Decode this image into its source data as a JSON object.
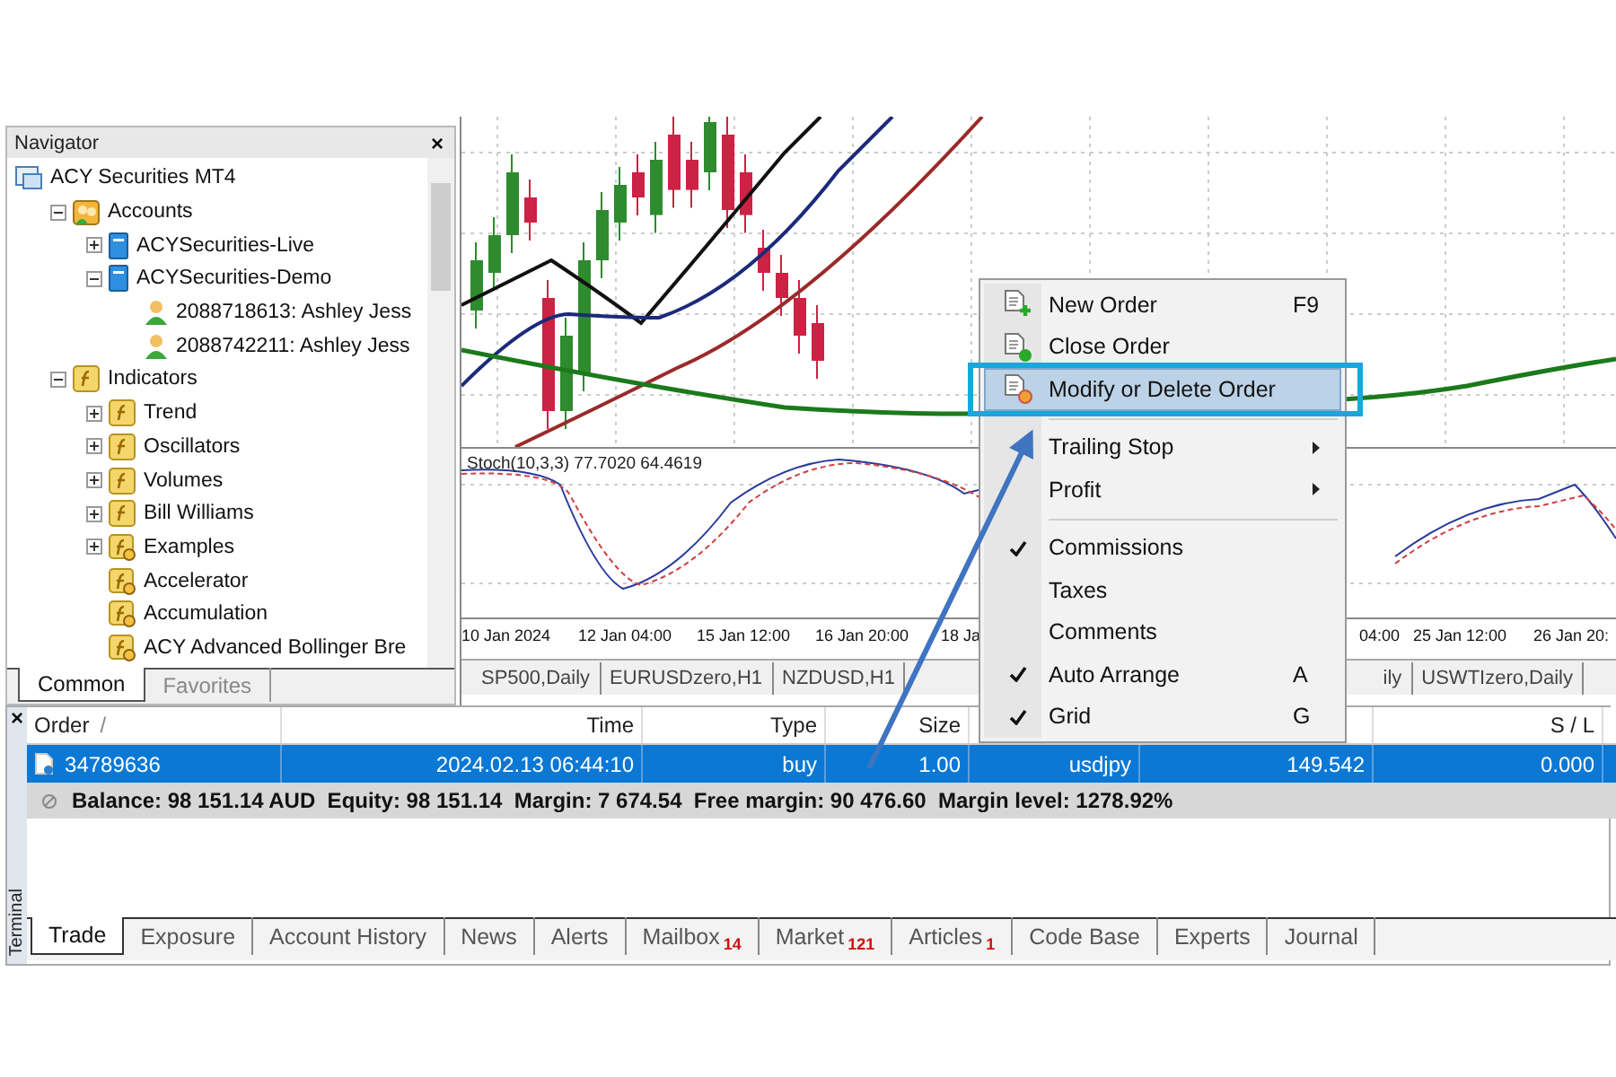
{
  "navigator": {
    "title": "Navigator",
    "close": "×",
    "tree": [
      {
        "label": "ACY Securities MT4",
        "kind": "terminal",
        "children": [
          {
            "label": "Accounts",
            "kind": "accounts",
            "expanded": true,
            "children": [
              {
                "label": "ACYSecurities-Live",
                "kind": "server",
                "expanded": false
              },
              {
                "label": "ACYSecurities-Demo",
                "kind": "server",
                "expanded": true,
                "children": [
                  {
                    "label": "2088718613: Ashley Jess",
                    "kind": "user"
                  },
                  {
                    "label": "2088742211: Ashley Jess",
                    "kind": "user"
                  }
                ]
              }
            ]
          },
          {
            "label": "Indicators",
            "kind": "folder",
            "expanded": true,
            "children": [
              {
                "label": "Trend",
                "kind": "folder",
                "expanded": false
              },
              {
                "label": "Oscillators",
                "kind": "folder",
                "expanded": false
              },
              {
                "label": "Volumes",
                "kind": "folder",
                "expanded": false
              },
              {
                "label": "Bill Williams",
                "kind": "folder",
                "expanded": false
              },
              {
                "label": "Examples",
                "kind": "indicator",
                "expanded": false
              },
              {
                "label": "Accelerator",
                "kind": "indicator"
              },
              {
                "label": "Accumulation",
                "kind": "indicator"
              },
              {
                "label": "ACY Advanced Bollinger Bre",
                "kind": "indicator"
              }
            ]
          }
        ]
      }
    ],
    "tabs": [
      {
        "label": "Common",
        "selected": true
      },
      {
        "label": "Favorites",
        "selected": false
      }
    ]
  },
  "chart": {
    "indicator_label": "Stoch(10,3,3) 77.7020 64.4619",
    "axis_labels": [
      "10 Jan 2024",
      "12 Jan 04:00",
      "15 Jan 12:00",
      "16 Jan 20:00",
      "18 Ja",
      "04:00",
      "25 Jan 12:00",
      "26 Jan 20:"
    ],
    "tabs": [
      "SP500,Daily",
      "EURUSDzero,H1",
      "NZDUSD,H1",
      "ily",
      "USWTIzero,Daily"
    ]
  },
  "context_menu": {
    "items": [
      {
        "kind": "item",
        "label": "New Order",
        "shortcut": "F9",
        "selected": false
      },
      {
        "kind": "item",
        "label": "Close Order",
        "selected": false
      },
      {
        "kind": "item",
        "label": "Modify or Delete Order",
        "selected": true
      },
      {
        "kind": "separator"
      },
      {
        "kind": "item",
        "label": "Trailing Stop",
        "submenu": true,
        "selected": false
      },
      {
        "kind": "item",
        "label": "Profit",
        "submenu": true,
        "selected": false
      },
      {
        "kind": "separator"
      },
      {
        "kind": "item",
        "label": "Commissions",
        "checked": true,
        "selected": false
      },
      {
        "kind": "item",
        "label": "Taxes",
        "checked": false,
        "selected": false
      },
      {
        "kind": "item",
        "label": "Comments",
        "checked": false,
        "selected": false
      },
      {
        "kind": "item",
        "label": "Auto Arrange",
        "shortcut": "A",
        "checked": true,
        "selected": false
      },
      {
        "kind": "item",
        "label": "Grid",
        "shortcut": "G",
        "checked": true,
        "selected": false
      }
    ]
  },
  "terminal": {
    "title": "Terminal",
    "close": "×",
    "columns": [
      {
        "label": "Order",
        "sort": "/"
      },
      {
        "label": "Time"
      },
      {
        "label": "Type"
      },
      {
        "label": "Size"
      },
      {},
      {},
      {
        "label": "S / L"
      },
      {}
    ],
    "rows": [
      {
        "selected": true,
        "cells": [
          "34789636",
          "2024.02.13 06:44:10",
          "buy",
          "1.00",
          "usdjpy",
          "149.542",
          "0.000",
          ""
        ]
      }
    ],
    "summary": "Balance: 98 151.14 AUD  Equity: 98 151.14  Margin: 7 674.54  Free margin: 90 476.60  Margin level: 1278.92%",
    "tabs": [
      {
        "label": "Trade",
        "selected": true
      },
      {
        "label": "Exposure",
        "selected": false
      },
      {
        "label": "Account History",
        "selected": false
      },
      {
        "label": "News",
        "selected": false
      },
      {
        "label": "Alerts",
        "selected": false
      },
      {
        "label": "Mailbox",
        "count": "14",
        "selected": false
      },
      {
        "label": "Market",
        "count": "121",
        "selected": false
      },
      {
        "label": "Articles",
        "count": "1",
        "selected": false
      },
      {
        "label": "Code Base",
        "selected": false
      },
      {
        "label": "Experts",
        "selected": false
      },
      {
        "label": "Journal",
        "selected": false
      }
    ]
  }
}
